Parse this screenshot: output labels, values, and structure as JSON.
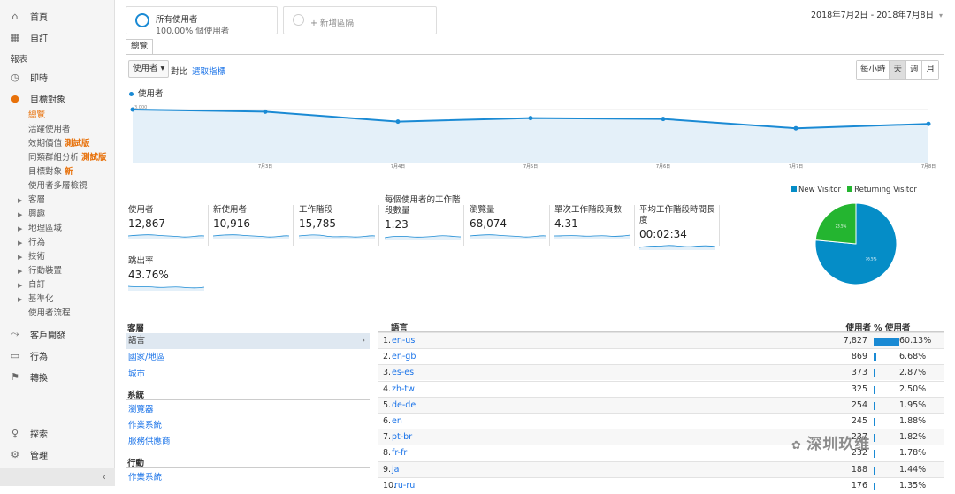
{
  "sidebar": {
    "home": "首頁",
    "custom": "自訂",
    "reports_header": "報表",
    "realtime": "即時",
    "audience": "目標對象",
    "audience_items": [
      {
        "label": "總覽",
        "tag": ""
      },
      {
        "label": "活躍使用者",
        "tag": ""
      },
      {
        "label": "效期價值",
        "tag": "測試版"
      },
      {
        "label": "同類群組分析",
        "tag": "測試版"
      },
      {
        "label": "目標對象",
        "tag": "新"
      },
      {
        "label": "使用者多層檢視",
        "tag": ""
      }
    ],
    "expandables": [
      "客層",
      "興趣",
      "地理區域",
      "行為",
      "技術",
      "行動裝置",
      "自訂",
      "基準化"
    ],
    "user_flow": "使用者流程",
    "acquisition": "客戶開發",
    "behavior": "行為",
    "conversions": "轉換",
    "discover": "探索",
    "admin": "管理",
    "collapse": "‹"
  },
  "segments": {
    "all_users": "所有使用者",
    "all_users_pct": "100.00% 個使用者",
    "add_segment": "+ 新增區隔"
  },
  "date_range": "2018年7月2日 - 2018年7月8日",
  "tab_overview": "總覽",
  "metric_select": "使用者 ▾",
  "vs_label": "對比",
  "pick_metric": "選取指標",
  "granularity": [
    "每小時",
    "天",
    "週",
    "月"
  ],
  "granularity_selected": "天",
  "chart_legend": "使用者",
  "chart_data": {
    "type": "line",
    "series": [
      {
        "name": "使用者",
        "values": [
          3000,
          2880,
          2320,
          2520,
          2470,
          1940,
          2190
        ]
      }
    ],
    "x_tick_labels": [
      "7月3日",
      "7月4日",
      "7月5日",
      "7月6日",
      "7月7日",
      "7月8日"
    ],
    "ytick_labels": [
      "3,000",
      "1,500"
    ],
    "ylim": [
      0,
      3500
    ],
    "color": "#1a8ad4"
  },
  "scorecards": [
    {
      "label": "使用者",
      "value": "12,867"
    },
    {
      "label": "新使用者",
      "value": "10,916"
    },
    {
      "label": "工作階段",
      "value": "15,785"
    },
    {
      "label": "每個使用者的工作階段數量",
      "value": "1.23"
    },
    {
      "label": "瀏覽量",
      "value": "68,074"
    },
    {
      "label": "單次工作階段頁數",
      "value": "4.31"
    },
    {
      "label": "平均工作階段時間長度",
      "value": "00:02:34"
    },
    {
      "label": "跳出率",
      "value": "43.76%"
    }
  ],
  "pie": {
    "legend": [
      {
        "name": "New Visitor",
        "color": "#058dc7"
      },
      {
        "name": "Returning Visitor",
        "color": "#24b530"
      }
    ],
    "values": [
      76.5,
      23.5
    ],
    "labels": [
      "76.5%",
      "23.5%"
    ]
  },
  "dimensions": {
    "demographics": "客層",
    "demographics_items": [
      "語言",
      "國家/地區",
      "城市"
    ],
    "system": "系統",
    "system_items": [
      "瀏覽器",
      "作業系統",
      "服務供應商"
    ],
    "mobile": "行動",
    "mobile_items": [
      "作業系統"
    ]
  },
  "table": {
    "col_language": "語言",
    "col_users": "使用者",
    "col_pct": "% 使用者",
    "rows": [
      {
        "n": "1.",
        "lang": "en-us",
        "users": "7,827",
        "pct": "60.13%",
        "pct_value": 60.13
      },
      {
        "n": "2.",
        "lang": "en-gb",
        "users": "869",
        "pct": "6.68%",
        "pct_value": 6.68
      },
      {
        "n": "3.",
        "lang": "es-es",
        "users": "373",
        "pct": "2.87%",
        "pct_value": 2.87
      },
      {
        "n": "4.",
        "lang": "zh-tw",
        "users": "325",
        "pct": "2.50%",
        "pct_value": 2.5
      },
      {
        "n": "5.",
        "lang": "de-de",
        "users": "254",
        "pct": "1.95%",
        "pct_value": 1.95
      },
      {
        "n": "6.",
        "lang": "en",
        "users": "245",
        "pct": "1.88%",
        "pct_value": 1.88
      },
      {
        "n": "7.",
        "lang": "pt-br",
        "users": "237",
        "pct": "1.82%",
        "pct_value": 1.82
      },
      {
        "n": "8.",
        "lang": "fr-fr",
        "users": "232",
        "pct": "1.78%",
        "pct_value": 1.78
      },
      {
        "n": "9.",
        "lang": "ja",
        "users": "188",
        "pct": "1.44%",
        "pct_value": 1.44
      },
      {
        "n": "10.",
        "lang": "ru-ru",
        "users": "176",
        "pct": "1.35%",
        "pct_value": 1.35
      }
    ]
  },
  "watermark": "深圳玖维"
}
